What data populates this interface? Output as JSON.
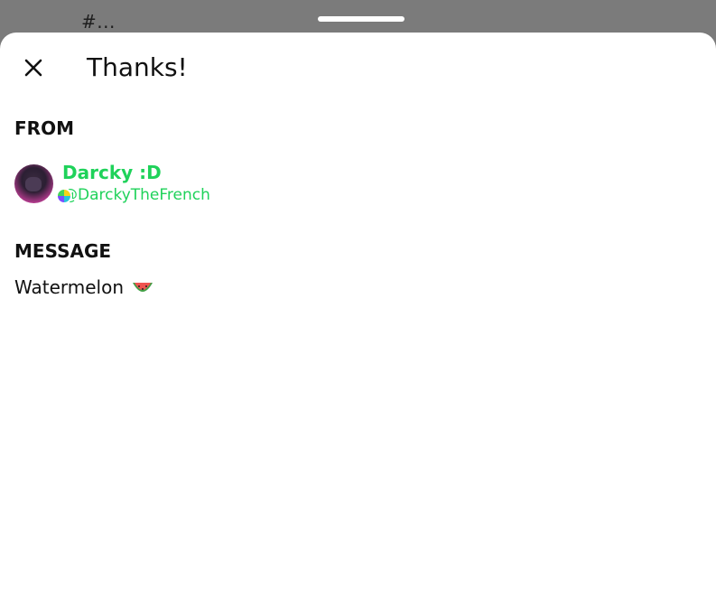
{
  "backdrop": {
    "partial_text": "#..."
  },
  "sheet": {
    "title": "Thanks!",
    "close_icon": "close-icon",
    "from_label": "FROM",
    "sender": {
      "display_name": "Darcky :D",
      "handle": "@DarckyTheFrench"
    },
    "message_label": "MESSAGE",
    "message_text": "Watermelon",
    "message_emoji_icon": "watermelon-icon"
  },
  "colors": {
    "accent_green": "#1fd25a",
    "backdrop": "#7b7b7b",
    "sheet_bg": "#ffffff"
  }
}
